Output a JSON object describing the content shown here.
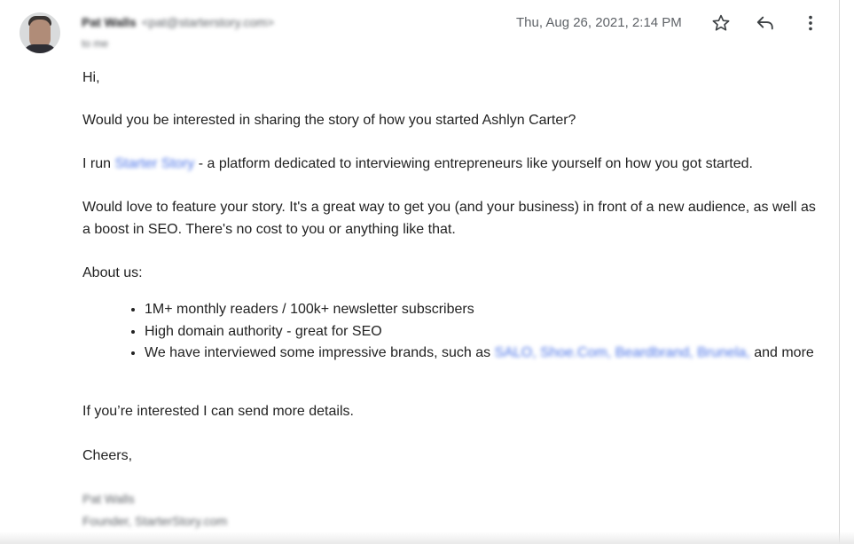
{
  "header": {
    "sender_name": "Pat Walls",
    "sender_email": "<pat@starterstory.com>",
    "recipient": "to me",
    "date": "Thu, Aug 26, 2021, 2:14 PM"
  },
  "icons": {
    "star": "star-icon",
    "reply": "reply-icon",
    "more": "more-vert-icon"
  },
  "body": {
    "greeting": "Hi,",
    "question": "Would you be interested in sharing the story of how you started Ashlyn Carter?",
    "intro_prefix": "I run",
    "intro_link": "Starter Story",
    "intro_suffix": " - a platform dedicated to interviewing entrepreneurs like yourself on how you got started.",
    "feature": "Would love to feature your story. It's a great way to get you (and your business) in front of a new audience, as well as a boost in SEO. There's no cost to you or anything like that.",
    "about": "About us:",
    "bullet1": "1M+ monthly readers / 100k+ newsletter subscribers",
    "bullet2": "High domain authority - great for SEO",
    "bullet3_prefix": "We have interviewed some impressive brands, such as",
    "bullet3_links": "SALO, Shoe.Com, Beardbrand, Brunela,",
    "bullet3_suffix": "and",
    "bullet3_more": "more",
    "followup": "If you’re interested I can send more details.",
    "closing": "Cheers,"
  },
  "signature": {
    "name": "Pat Walls",
    "title": "Founder, StarterStory.com"
  },
  "colors": {
    "link": "#4a73e8",
    "text": "#222222",
    "muted": "#5f6368"
  }
}
